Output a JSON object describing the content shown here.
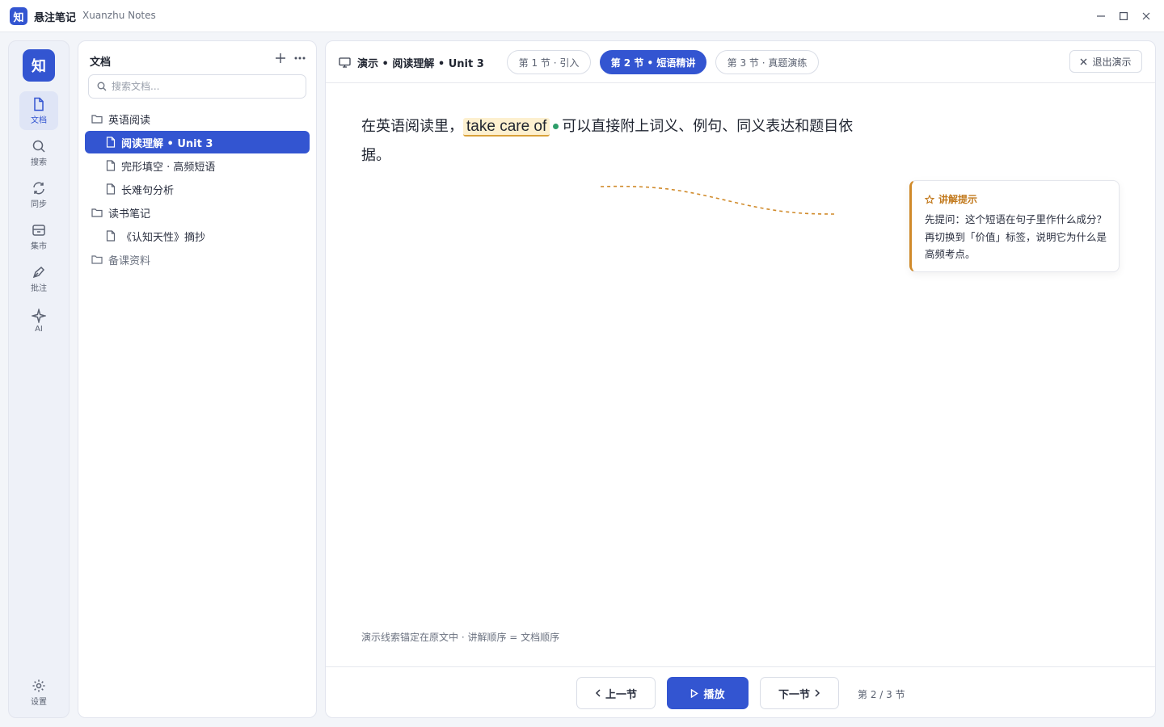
{
  "app": {
    "logo_char": "知",
    "title": "悬注笔记",
    "subtitle": "Xuanzhu Notes"
  },
  "window": {
    "minimize_icon": "minimize-icon",
    "maximize_icon": "maximize-icon",
    "close_icon": "close-icon"
  },
  "rail": {
    "logo_char": "知",
    "items": [
      {
        "label": "文档",
        "icon": "document-icon",
        "active": true
      },
      {
        "label": "搜索",
        "icon": "search-icon"
      },
      {
        "label": "同步",
        "icon": "sync-icon"
      },
      {
        "label": "集市",
        "icon": "archive-icon"
      },
      {
        "label": "批注",
        "icon": "pen-icon"
      },
      {
        "label": "AI",
        "icon": "sparkle-icon"
      }
    ],
    "settings_label": "设置"
  },
  "docs": {
    "title": "文档",
    "search_placeholder": "搜索文档...",
    "tree": [
      {
        "type": "folder",
        "label": "英语阅读"
      },
      {
        "type": "file",
        "label": "阅读理解 • Unit 3",
        "selected": true
      },
      {
        "type": "file",
        "label": "完形填空 · 高频短语"
      },
      {
        "type": "file",
        "label": "长难句分析"
      },
      {
        "type": "folder",
        "label": "读书笔记"
      },
      {
        "type": "file",
        "label": "《认知天性》摘抄"
      },
      {
        "type": "folder",
        "label": "备课资料"
      }
    ]
  },
  "presentation": {
    "title": "演示 • 阅读理解 • Unit 3",
    "tabs": [
      {
        "label": "第 1 节 · 引入"
      },
      {
        "label": "第 2 节 • 短语精讲",
        "active": true
      },
      {
        "label": "第 3 节 · 真题演练"
      }
    ],
    "exit_label": "退出演示",
    "text_before": "在英语阅读里，",
    "phrase": "take care of",
    "text_after": "可以直接附上词义、例句、同义表达和题目依据。",
    "hint": {
      "title": "讲解提示",
      "body": "先提问：这个短语在句子里作什么成分？再切换到「价值」标签，说明它为什么是高频考点。"
    },
    "footnote": "演示线索锚定在原文中 · 讲解顺序 = 文档顺序",
    "prev_label": "上一节",
    "play_label": "播放",
    "next_label": "下一节",
    "page_indicator": "第 2 / 3 节"
  },
  "colors": {
    "accent": "#3355d1",
    "highlight": "#fdf0cf",
    "hint_accent": "#d08a2a",
    "anchor_dot": "#2e9e6a"
  }
}
